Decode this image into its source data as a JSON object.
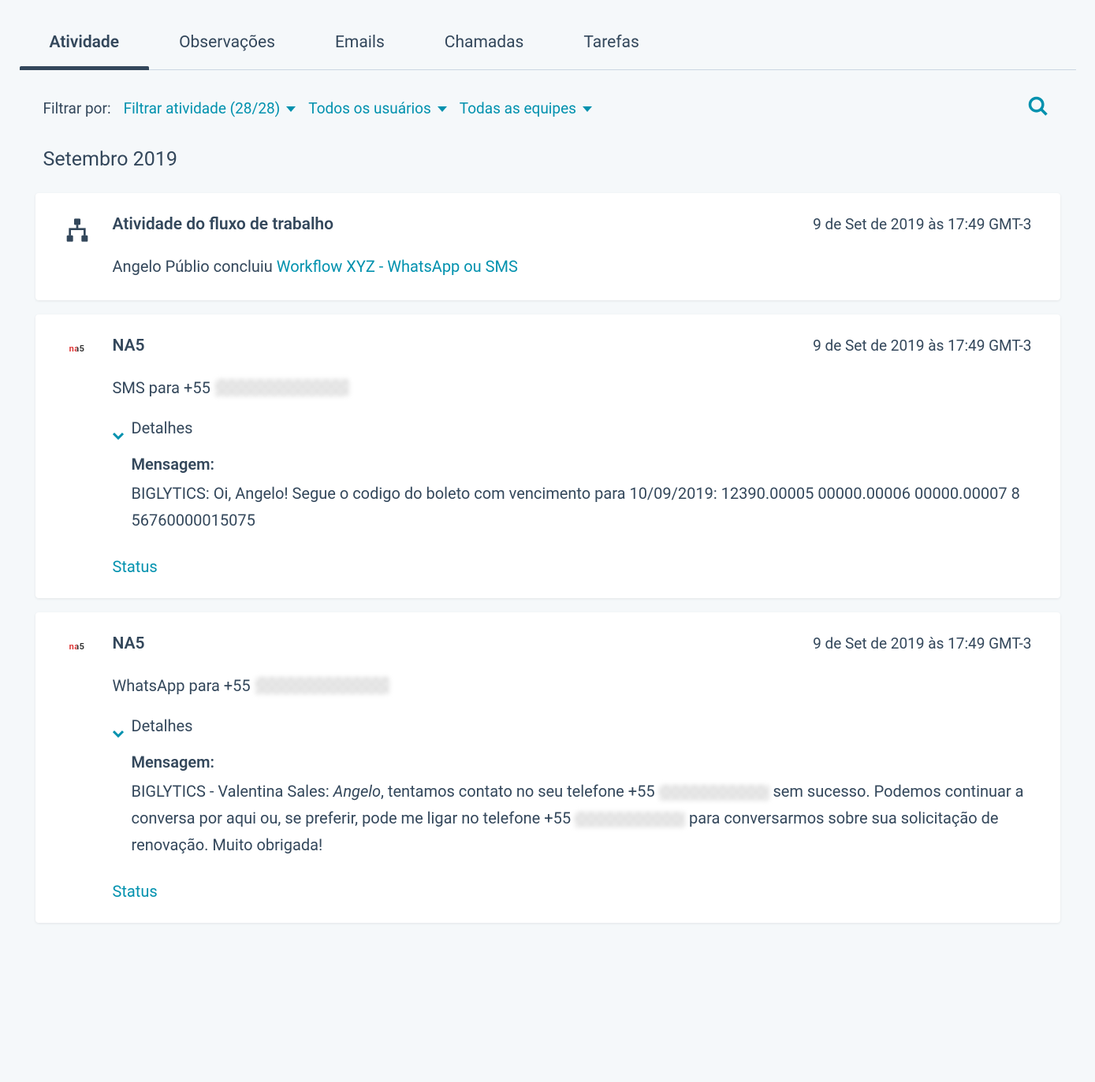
{
  "tabs": [
    {
      "label": "Atividade",
      "active": true
    },
    {
      "label": "Observações",
      "active": false
    },
    {
      "label": "Emails",
      "active": false
    },
    {
      "label": "Chamadas",
      "active": false
    },
    {
      "label": "Tarefas",
      "active": false
    }
  ],
  "filters": {
    "label": "Filtrar por:",
    "activity": "Filtrar atividade (28/28)",
    "users": "Todos os usuários",
    "teams": "Todas as equipes"
  },
  "month_header": "Setembro 2019",
  "cards": [
    {
      "type": "workflow",
      "title": "Atividade do fluxo de trabalho",
      "timestamp": "9 de Set de 2019 às 17:49 GMT-3",
      "description_prefix": "Angelo Públio concluiu ",
      "workflow_link": "Workflow XYZ - WhatsApp ou SMS"
    },
    {
      "type": "na5",
      "title": "NA5",
      "timestamp": "9 de Set de 2019 às 17:49 GMT-3",
      "description": "SMS para +55 ",
      "details_toggle": "Detalhes",
      "message_label": "Mensagem:",
      "message_body": "BIGLYTICS: Oi, Angelo! Segue o codigo do boleto com vencimento para 10/09/2019: 12390.00005 00000.00006 00000.00007 8 56760000015075",
      "status_link": "Status"
    },
    {
      "type": "na5",
      "title": "NA5",
      "timestamp": "9 de Set de 2019 às 17:49 GMT-3",
      "description": "WhatsApp para +55 ",
      "details_toggle": "Detalhes",
      "message_label": "Mensagem:",
      "message_prefix": "BIGLYTICS - Valentina Sales: ",
      "message_em": "Angelo",
      "message_mid1": ", tentamos contato no seu telefone +55 ",
      "message_mid2": " sem sucesso. Podemos continuar a conversa por aqui ou, se preferir, pode  me ligar no telefone +55 ",
      "message_end": " para conversarmos sobre sua solicitação de renovação. Muito obrigada!",
      "status_link": "Status"
    }
  ]
}
